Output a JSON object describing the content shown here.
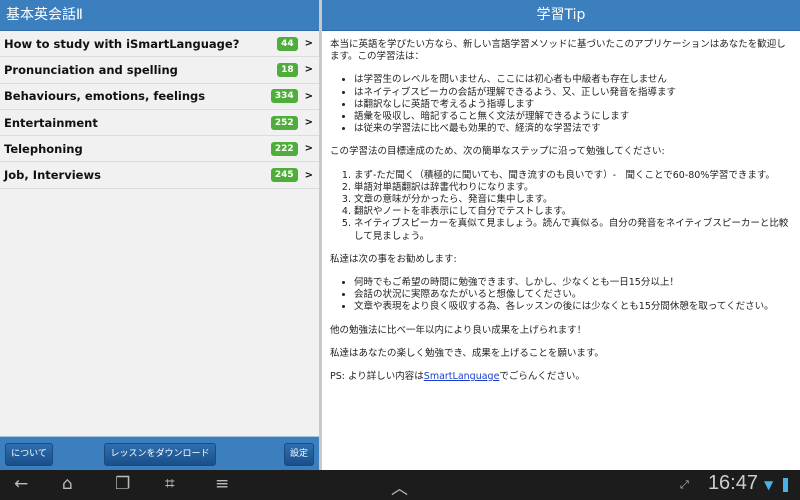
{
  "left": {
    "title": "基本英会話Ⅱ",
    "items": [
      {
        "label": "How to study with iSmartLanguage?",
        "count": "44"
      },
      {
        "label": "Pronunciation and spelling",
        "count": "18"
      },
      {
        "label": "Behaviours, emotions, feelings",
        "count": "334"
      },
      {
        "label": "Entertainment",
        "count": "252"
      },
      {
        "label": "Telephoning",
        "count": "222"
      },
      {
        "label": "Job, Interviews",
        "count": "245"
      }
    ],
    "buttons": {
      "about": "について",
      "download": "レッスンをダウンロード",
      "settings": "設定"
    }
  },
  "right": {
    "title": "学習Tip",
    "intro": "本当に英語を学びたい方なら、新しい言語学習メソッドに基づいたこのアプリケーションはあなたを歓迎します。この学習法は：",
    "bullets1": [
      "は学習生のレベルを問いません、ここには初心者も中級者も存在しません",
      "はネイティブスピーカの会話が理解できるよう、又、正しい発音を指導ます",
      "は翻訳なしに英語で考えるよう指導します",
      "語彙を吸収し、暗記すること無く文法が理解できるようにします",
      "は従来の学習法に比べ最も効果的で、経済的な学習法です"
    ],
    "steps_intro": "この学習法の目標達成のため、次の簡単なステップに沿って勉強してください:",
    "steps": [
      "まず-ただ聞く（積極的に聞いても、聞き流すのも良いです）-　聞くことで60-80%学習できます。",
      "単語対単語翻訳は辞書代わりになります。",
      "文章の意味が分かったら、発音に集中します。",
      "翻訳やノートを非表示にして自分でテストします。",
      "ネイティブスピーカーを真似て見ましょう。読んで真似る。自分の発音をネイティブスピーカーと比較して見ましょう。"
    ],
    "recommend_intro": "私達は次の事をお勧めします:",
    "bullets2": [
      "何時でもご希望の時間に勉強できます、しかし、少なくとも一日15分以上！",
      "会話の状況に実際あなたがいると想像してください。",
      "文章や表現をより良く吸収する為、各レッスンの後には少なくとも15分間休憩を取ってください。"
    ],
    "p1": "他の勉強法に比べ一年以内により良い成果を上げられます！",
    "p2": "私達はあなたの楽しく勉強でき、成果を上げることを願います。",
    "ps_prefix": "PS: より詳しい内容は",
    "ps_link": "SmartLanguage",
    "ps_suffix": "でごらんください。"
  },
  "nav": {
    "time": "16:47"
  }
}
